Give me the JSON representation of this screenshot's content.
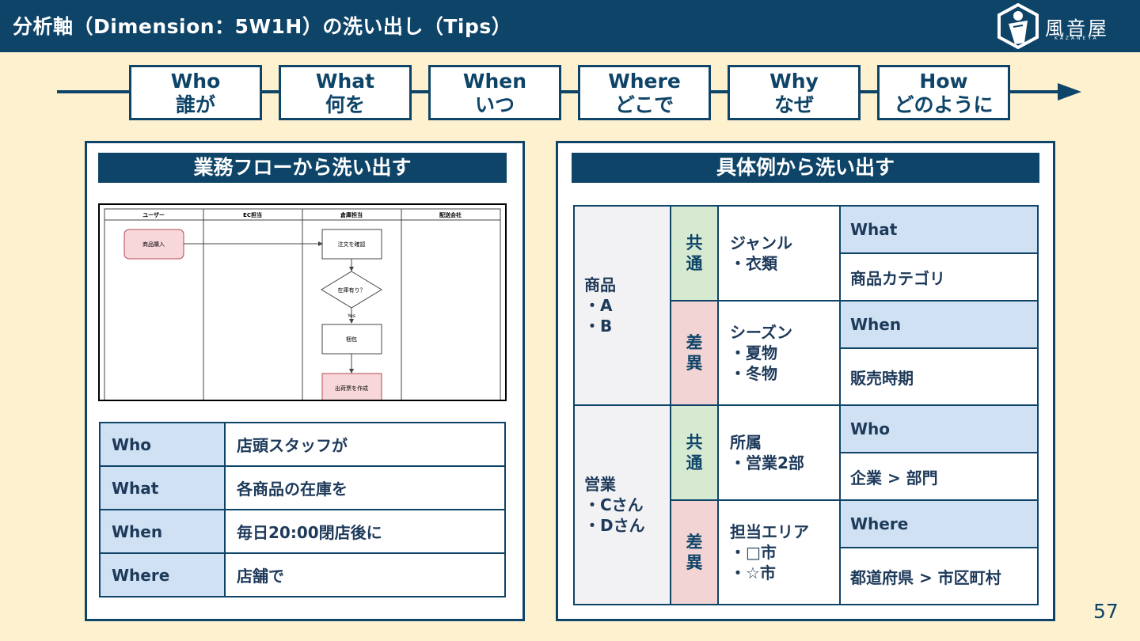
{
  "header": {
    "title": "分析軸（Dimension：5W1H）の洗い出し（Tips）",
    "logo_text": "風音屋",
    "logo_sub": "KAZANEYA"
  },
  "timeline": [
    {
      "en": "Who",
      "ja": "誰が"
    },
    {
      "en": "What",
      "ja": "何を"
    },
    {
      "en": "When",
      "ja": "いつ"
    },
    {
      "en": "Where",
      "ja": "どこで"
    },
    {
      "en": "Why",
      "ja": "なぜ"
    },
    {
      "en": "How",
      "ja": "どのように"
    }
  ],
  "left_panel": {
    "heading": "業務フローから洗い出す",
    "flow": {
      "lanes": [
        "ユーザー",
        "EC担当",
        "倉庫担当",
        "配送会社"
      ],
      "nodes": {
        "purchase": "商品購入",
        "confirm": "注文を確認",
        "stock": "在庫有り？",
        "yes": "Yes",
        "pack": "梱包",
        "slip": "出荷票を作成"
      }
    },
    "table": [
      {
        "key": "Who",
        "value": "店頭スタッフが"
      },
      {
        "key": "What",
        "value": "各商品の在庫を"
      },
      {
        "key": "When",
        "value": "毎日20:00閉店後に"
      },
      {
        "key": "Where",
        "value": "店舗で"
      }
    ]
  },
  "right_panel": {
    "heading": "具体例から洗い出す",
    "groups": [
      {
        "item_lines": [
          "商品",
          "・A",
          "・B"
        ],
        "rows": [
          {
            "tag": [
              "共",
              "通"
            ],
            "value_lines": [
              "ジャンル",
              "・衣類"
            ],
            "dim": "What",
            "sub": "商品カテゴリ"
          },
          {
            "tag": [
              "差",
              "異"
            ],
            "value_lines": [
              "シーズン",
              "・夏物",
              "・冬物"
            ],
            "dim": "When",
            "sub": "販売時期"
          }
        ]
      },
      {
        "item_lines": [
          "営業",
          "・Cさん",
          "・Dさん"
        ],
        "rows": [
          {
            "tag": [
              "共",
              "通"
            ],
            "value_lines": [
              "所属",
              "・営業2部"
            ],
            "dim": "Who",
            "sub": "企業 > 部門"
          },
          {
            "tag": [
              "差",
              "異"
            ],
            "value_lines": [
              "担当エリア",
              "・□市",
              "・☆市"
            ],
            "dim": "Where",
            "sub": "都道府県 > 市区町村"
          }
        ]
      }
    ]
  },
  "page_number": "57"
}
